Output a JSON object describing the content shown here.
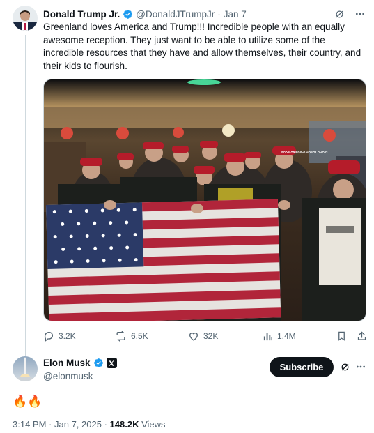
{
  "tweet1": {
    "author_name": "Donald Trump Jr.",
    "handle": "@DonaldJTrumpJr",
    "separator": "·",
    "date": "Jan 7",
    "text": "Greenland loves America and Trump!!! Incredible people with an equally awesome reception. They just want to be able to utilize some of the incredible resources that they have and allow themselves, their country, and their kids to flourish.",
    "media_hat_text": "MAKE AMERICA GREAT AGAIN",
    "actions": {
      "replies": "3.2K",
      "reposts": "6.5K",
      "likes": "32K",
      "views": "1.4M"
    }
  },
  "tweet2": {
    "author_name": "Elon Musk",
    "handle": "@elonmusk",
    "subscribe_label": "Subscribe",
    "text": "🔥🔥",
    "time": "3:14 PM",
    "date": "Jan 7, 2025",
    "views_count": "148.2K",
    "views_label": "Views"
  },
  "colors": {
    "text": "#0f1419",
    "muted": "#536471",
    "verified": "#1d9bf0",
    "border": "#cfd9de"
  }
}
